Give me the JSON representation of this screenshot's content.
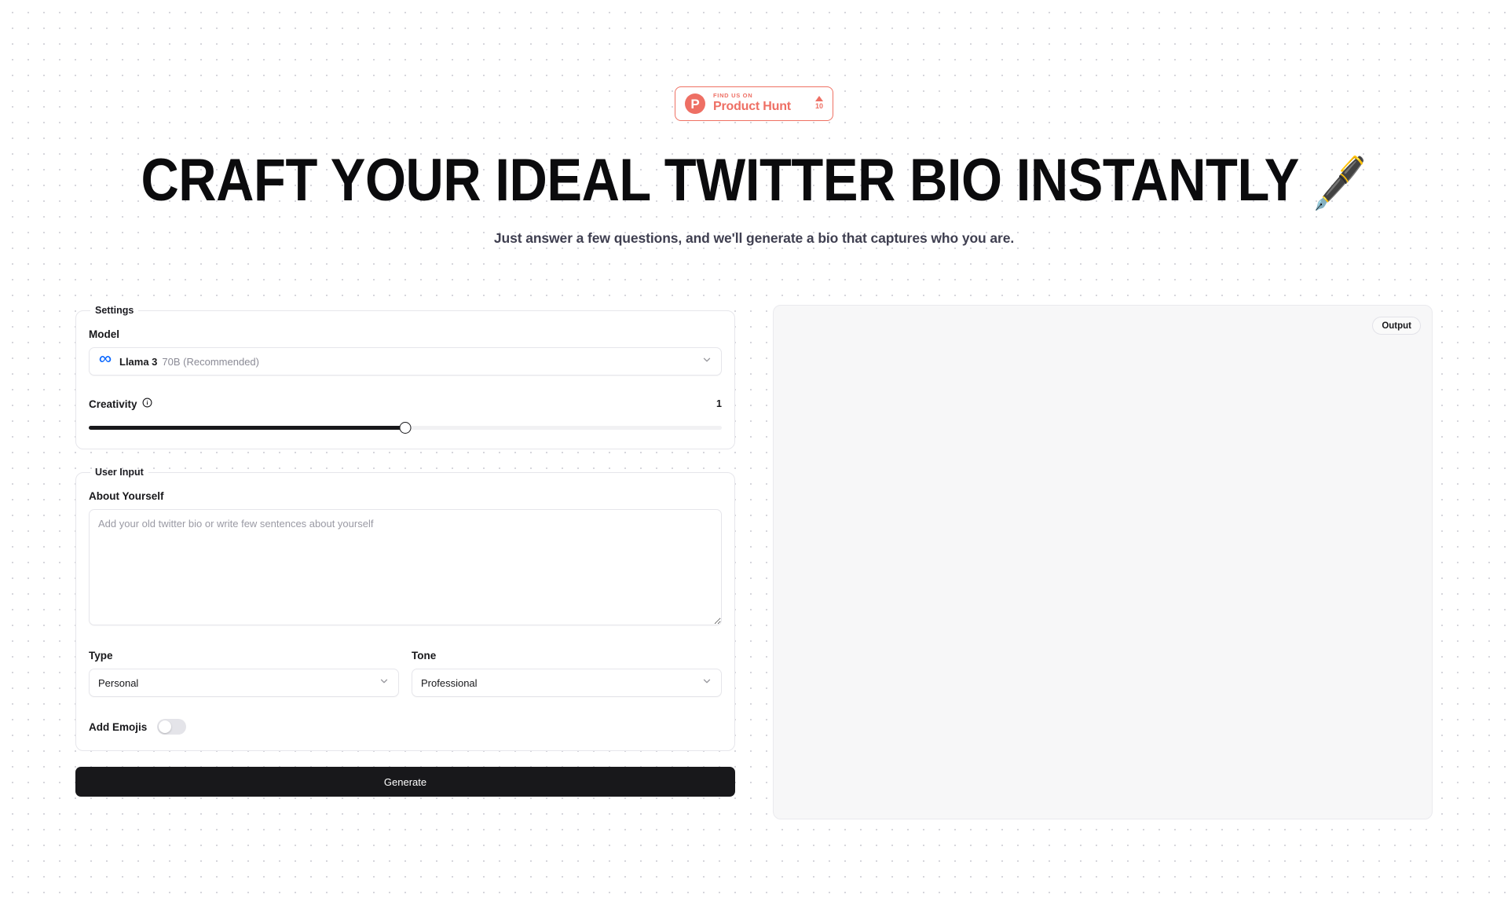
{
  "product_hunt": {
    "kicker": "FIND US ON",
    "title": "Product Hunt",
    "upvotes": "10"
  },
  "hero": {
    "title": "CRAFT YOUR IDEAL TWITTER BIO INSTANTLY",
    "emoji": "🖋️",
    "subtitle": "Just answer a few questions, and we'll generate a bio that captures who you are."
  },
  "settings": {
    "legend": "Settings",
    "model": {
      "label": "Model",
      "icon": "meta-infinity-icon",
      "name": "Llama 3",
      "variant": "70B (Recommended)"
    },
    "creativity": {
      "label": "Creativity",
      "info_icon": "info-circle-icon",
      "value": "1",
      "percent": 50
    }
  },
  "user_input": {
    "legend": "User Input",
    "about": {
      "label": "About Yourself",
      "placeholder": "Add your old twitter bio or write few sentences about yourself",
      "value": ""
    },
    "type": {
      "label": "Type",
      "value": "Personal"
    },
    "tone": {
      "label": "Tone",
      "value": "Professional"
    },
    "add_emojis": {
      "label": "Add Emojis",
      "enabled": false
    }
  },
  "actions": {
    "generate_label": "Generate"
  },
  "output": {
    "badge_label": "Output",
    "content": ""
  },
  "colors": {
    "brand_red": "#ee6f64",
    "meta_blue": "#0866ff",
    "dark": "#18181b",
    "panel_bg": "#f7f7f8"
  }
}
